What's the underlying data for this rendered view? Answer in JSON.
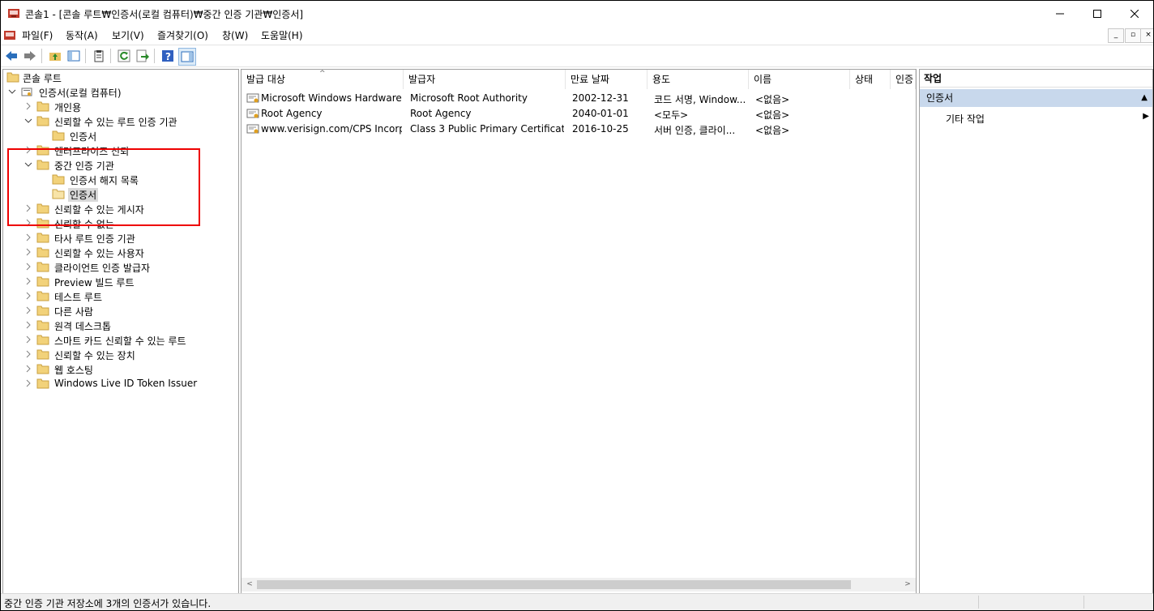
{
  "window": {
    "title": "콘솔1 - [콘솔 루트₩인증서(로컬 컴퓨터)₩중간 인증 기관₩인증서]"
  },
  "menu": [
    "파일(F)",
    "동작(A)",
    "보기(V)",
    "즐겨찾기(O)",
    "창(W)",
    "도움말(H)"
  ],
  "tree": {
    "root": "콘솔 루트",
    "store": "인증서(로컬 컴퓨터)",
    "items": [
      {
        "label": "개인용"
      },
      {
        "label": "신뢰할 수 있는 루트 인증 기관"
      },
      {
        "label": "인증서"
      },
      {
        "label": "엔터프라이즈 신뢰"
      },
      {
        "label": "중간 인증 기관"
      },
      {
        "label": "인증서 해지 목록"
      },
      {
        "label": "인증서"
      },
      {
        "label": "신뢰할 수 있는 게시자"
      },
      {
        "label": "신뢰할 수 없는"
      },
      {
        "label": "타사 루트 인증 기관"
      },
      {
        "label": "신뢰할 수 있는 사용자"
      },
      {
        "label": "클라이언트 인증 발급자"
      },
      {
        "label": "Preview 빌드 루트"
      },
      {
        "label": "테스트 루트"
      },
      {
        "label": "다른 사람"
      },
      {
        "label": "원격 데스크톱"
      },
      {
        "label": "스마트 카드 신뢰할 수 있는 루트"
      },
      {
        "label": "신뢰할 수 있는 장치"
      },
      {
        "label": "웹 호스팅"
      },
      {
        "label": "Windows Live ID Token Issuer"
      }
    ]
  },
  "list": {
    "columns": [
      "발급 대상",
      "발급자",
      "만료 날짜",
      "용도",
      "이름",
      "상태",
      "인증"
    ],
    "rows": [
      {
        "subject": "Microsoft Windows Hardware ...",
        "issuer": "Microsoft Root Authority",
        "expires": "2002-12-31",
        "purpose": "코드 서명, Window...",
        "name": "<없음>"
      },
      {
        "subject": "Root Agency",
        "issuer": "Root Agency",
        "expires": "2040-01-01",
        "purpose": "<모두>",
        "name": "<없음>"
      },
      {
        "subject": "www.verisign.com/CPS Incorp....",
        "issuer": "Class 3 Public Primary Certificati...",
        "expires": "2016-10-25",
        "purpose": "서버 인증, 클라이...",
        "name": "<없음>"
      }
    ]
  },
  "actions": {
    "title": "작업",
    "section": "인증서",
    "item": "기타 작업"
  },
  "status": {
    "message": "중간 인증 기관 저장소에 3개의 인증서가 있습니다."
  },
  "colors": {
    "highlight": "#e00000",
    "section_bg": "#c8d8ec",
    "selected_bg": "#d9d9d9"
  }
}
